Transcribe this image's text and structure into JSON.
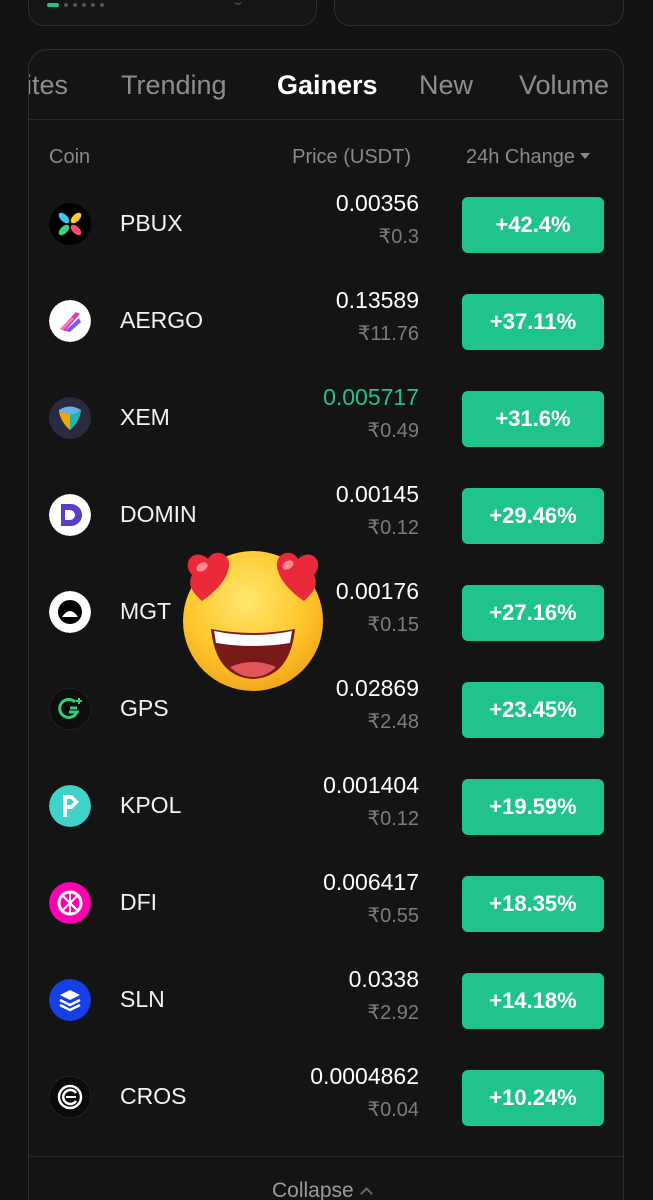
{
  "tabs": [
    {
      "label": "rites"
    },
    {
      "label": "Trending"
    },
    {
      "label": "Gainers"
    },
    {
      "label": "New"
    },
    {
      "label": "Volume"
    }
  ],
  "active_tab": "Gainers",
  "columns": {
    "coin": "Coin",
    "price": "Price (USDT)",
    "change": "24h Change"
  },
  "coins": [
    {
      "symbol": "PBUX",
      "price": "0.00356",
      "inr": "₹0.3",
      "change": "+42.4%",
      "icon": "pbux-icon"
    },
    {
      "symbol": "AERGO",
      "price": "0.13589",
      "inr": "₹11.76",
      "change": "+37.11%",
      "icon": "aergo-icon"
    },
    {
      "symbol": "XEM",
      "price": "0.005717",
      "inr": "₹0.49",
      "change": "+31.6%",
      "icon": "xem-icon",
      "price_highlight": true
    },
    {
      "symbol": "DOMIN",
      "price": "0.00145",
      "inr": "₹0.12",
      "change": "+29.46%",
      "icon": "domin-icon"
    },
    {
      "symbol": "MGT",
      "price": "0.00176",
      "inr": "₹0.15",
      "change": "+27.16%",
      "icon": "mgt-icon"
    },
    {
      "symbol": "GPS",
      "price": "0.02869",
      "inr": "₹2.48",
      "change": "+23.45%",
      "icon": "gps-icon"
    },
    {
      "symbol": "KPOL",
      "price": "0.001404",
      "inr": "₹0.12",
      "change": "+19.59%",
      "icon": "kpol-icon"
    },
    {
      "symbol": "DFI",
      "price": "0.006417",
      "inr": "₹0.55",
      "change": "+18.35%",
      "icon": "dfi-icon"
    },
    {
      "symbol": "SLN",
      "price": "0.0338",
      "inr": "₹2.92",
      "change": "+14.18%",
      "icon": "sln-icon"
    },
    {
      "symbol": "CROS",
      "price": "0.0004862",
      "inr": "₹0.04",
      "change": "+10.24%",
      "icon": "cros-icon"
    }
  ],
  "collapse_label": "Collapse",
  "overlay": {
    "icon": "heart-eyes-emoji-icon"
  },
  "colors": {
    "accent": "#1fc38b",
    "background": "#121212",
    "muted": "#8a8a8a"
  }
}
